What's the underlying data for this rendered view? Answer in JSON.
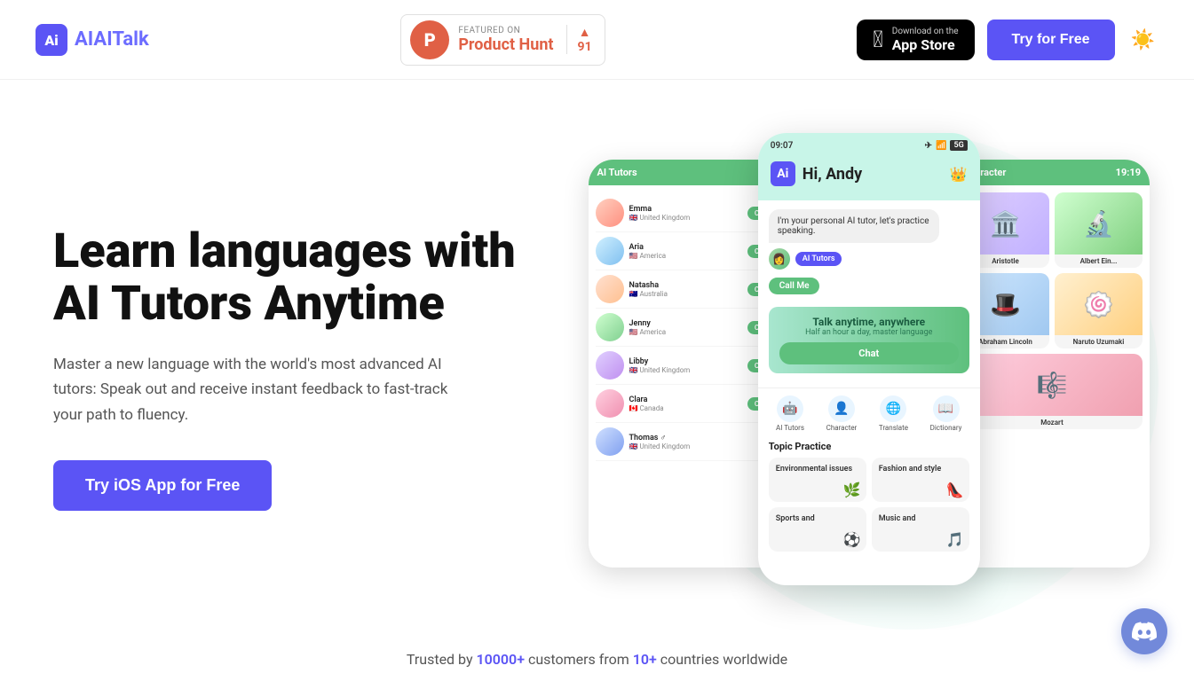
{
  "navbar": {
    "logo_text": "AITalk",
    "product_hunt": {
      "featured_label": "FEATURED ON",
      "name": "Product Hunt",
      "votes": "91"
    },
    "app_store": {
      "small": "Download on the",
      "big": "App Store"
    },
    "try_free_label": "Try for Free"
  },
  "hero": {
    "title_line1": "Learn languages with",
    "title_line2": "AI Tutors Anytime",
    "subtitle": "Master a new language with the world's most advanced AI tutors: Speak out and receive instant feedback to fast-track your path to fluency.",
    "cta_label": "Try iOS App for Free"
  },
  "phone_main": {
    "status_time": "09:07",
    "greeting": "Hi, Andy",
    "bot_message": "I'm your personal AI tutor, let's practice speaking.",
    "ai_tutors_label": "AI Tutors",
    "call_me_label": "Call Me",
    "banner_title": "Talk anytime, anywhere",
    "banner_sub": "Half an hour a day, master language",
    "chat_btn_label": "Chat",
    "icons": [
      {
        "emoji": "🤖",
        "label": "AI Tutors"
      },
      {
        "emoji": "👤",
        "label": "Character"
      },
      {
        "emoji": "🌐",
        "label": "Translate"
      },
      {
        "emoji": "📖",
        "label": "Dictionary"
      }
    ],
    "topic_title": "Topic Practice",
    "topics": [
      {
        "name": "Environmental issues",
        "emoji": "🌿"
      },
      {
        "name": "Fashion and style",
        "emoji": "👠"
      },
      {
        "name": "Sports and",
        "emoji": "⚽"
      },
      {
        "name": "Music and",
        "emoji": "🎵"
      }
    ]
  },
  "phone_left": {
    "header": "AI Tutors",
    "tutors": [
      {
        "name": "Emma",
        "location": "🇬🇧 United Kingdom"
      },
      {
        "name": "Aria",
        "location": "🇺🇸 America"
      },
      {
        "name": "Natasha",
        "location": "🇦🇺 Australia"
      },
      {
        "name": "Jenny",
        "location": "🇺🇸 America"
      },
      {
        "name": "Libby",
        "location": "🇬🇧 United Kingdom"
      },
      {
        "name": "Clara",
        "location": "🇨🇦 Canada"
      },
      {
        "name": "Thomas",
        "location": "🇬🇧 United Kingdom"
      }
    ],
    "chat_btn": "Chat"
  },
  "phone_right": {
    "header": "Character",
    "timestamp": "19:19",
    "characters": [
      {
        "name": "Aristotle",
        "emoji": "🏛️",
        "type": "aristotle"
      },
      {
        "name": "Albert Ein...",
        "emoji": "🔬",
        "type": "einstein"
      },
      {
        "name": "Abraham Lincoln",
        "emoji": "🎩",
        "type": "lincoln"
      },
      {
        "name": "Naruto Uzumaki",
        "emoji": "🍥",
        "type": "naruto"
      },
      {
        "name": "Mozart",
        "emoji": "🎼",
        "type": "mozart"
      }
    ]
  },
  "trusted": {
    "prefix": "Trusted by ",
    "customers": "10000+",
    "middle": " customers from ",
    "countries": "10+",
    "suffix": " countries worldwide"
  },
  "theme_icon": "☀️"
}
